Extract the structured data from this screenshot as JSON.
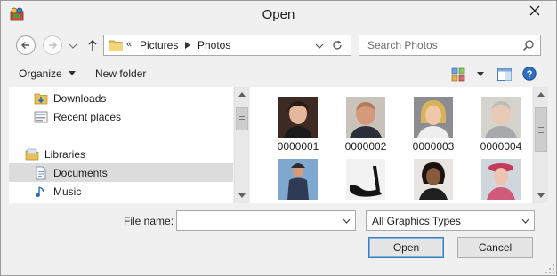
{
  "window": {
    "title": "Open",
    "app_icon": "app-icon",
    "close_icon": "close-icon"
  },
  "nav": {
    "back_icon": "back-arrow-icon",
    "forward_icon": "forward-arrow-icon",
    "up_icon": "up-arrow-icon",
    "address": {
      "overflow": "«",
      "breadcrumbs": [
        "Pictures",
        "Photos"
      ]
    },
    "search": {
      "placeholder": "Search Photos",
      "icon": "search-icon"
    }
  },
  "toolbar": {
    "organize_label": "Organize",
    "new_folder_label": "New folder"
  },
  "sidebar": {
    "items": [
      {
        "label": "Downloads",
        "icon": "downloads-folder-icon"
      },
      {
        "label": "Recent places",
        "icon": "recent-places-icon"
      },
      {
        "label": "Libraries",
        "icon": "libraries-icon"
      },
      {
        "label": "Documents",
        "icon": "documents-icon",
        "selected": true
      },
      {
        "label": "Music",
        "icon": "music-icon"
      }
    ]
  },
  "files": [
    {
      "name": "0000001"
    },
    {
      "name": "0000002"
    },
    {
      "name": "0000003"
    },
    {
      "name": "0000004"
    },
    {
      "name": ""
    },
    {
      "name": ""
    },
    {
      "name": ""
    },
    {
      "name": ""
    }
  ],
  "bottom": {
    "file_name_label": "File name:",
    "file_name_value": "",
    "file_type_selected": "All Graphics Types",
    "open_label": "Open",
    "cancel_label": "Cancel"
  },
  "colors": {
    "selected_row": "#dcdcdc",
    "default_button_border": "#3c7fb1",
    "folder_yellow": "#e8c255"
  }
}
